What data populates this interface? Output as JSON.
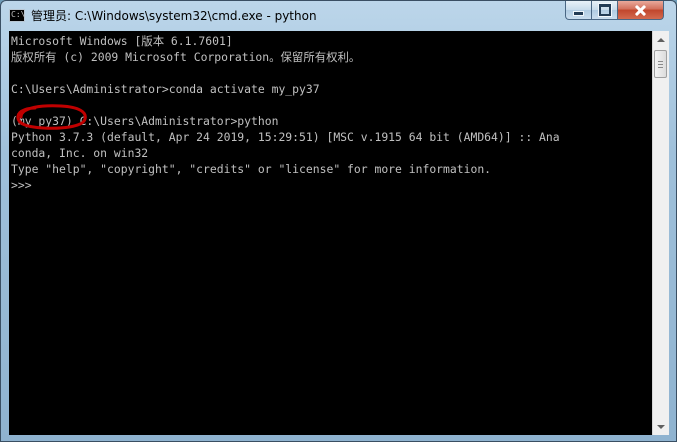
{
  "window": {
    "title": "管理员: C:\\Windows\\system32\\cmd.exe - python"
  },
  "console": {
    "lines": [
      "Microsoft Windows [版本 6.1.7601]",
      "版权所有 (c) 2009 Microsoft Corporation。保留所有权利。",
      "",
      "C:\\Users\\Administrator>conda activate my_py37",
      "",
      "(my_py37) C:\\Users\\Administrator>python",
      "Python 3.7.3 (default, Apr 24 2019, 15:29:51) [MSC v.1915 64 bit (AMD64)] :: Ana",
      "conda, Inc. on win32",
      "Type \"help\", \"copyright\", \"credits\" or \"license\" for more information.",
      ">>>"
    ]
  },
  "colors": {
    "console_background": "#000000",
    "console_text": "#c0c0c0",
    "annotation": "#c00000"
  },
  "icons": {
    "app": "cmd-icon",
    "minimize": "minimize-icon",
    "maximize": "maximize-icon",
    "close": "close-icon"
  }
}
